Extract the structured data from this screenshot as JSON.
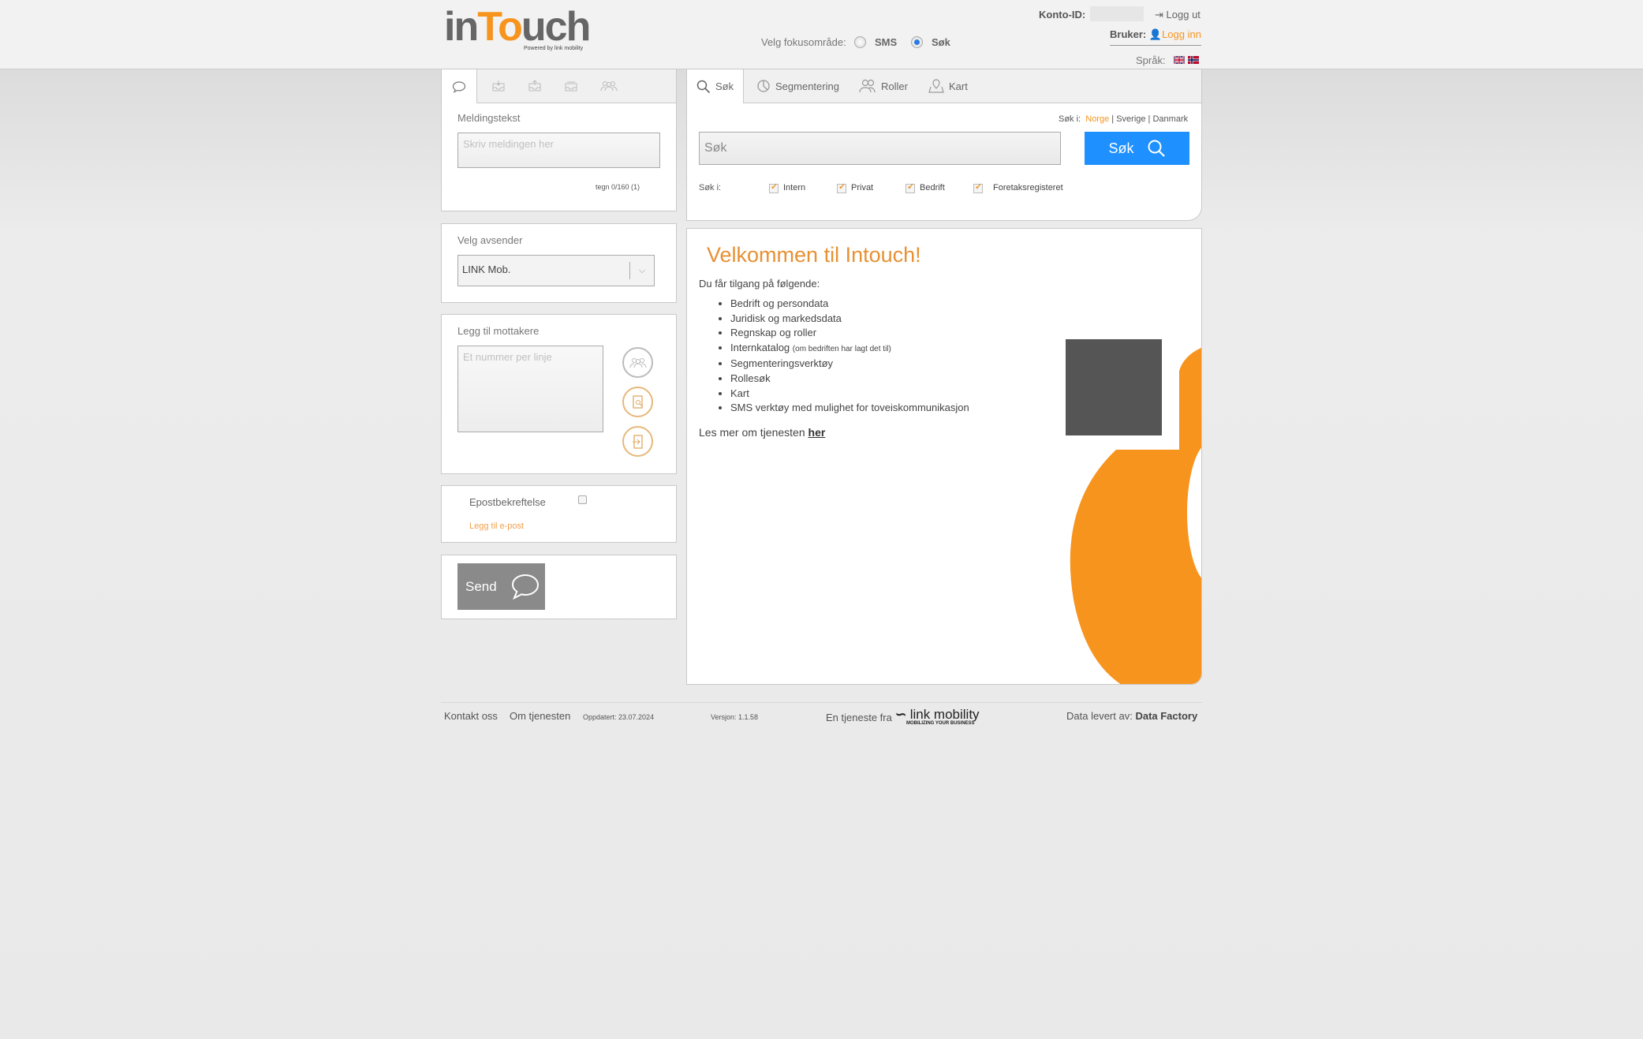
{
  "header": {
    "logo_left": "in",
    "logo_mid": "To",
    "logo_right": "uch",
    "logo_sub": "Powered by link mobility",
    "focus_label": "Velg fokusområde:",
    "focus_options": [
      "SMS",
      "Søk"
    ],
    "focus_selected": "Søk",
    "konto_label": "Konto-ID:",
    "logout": "Logg ut",
    "bruker_label": "Bruker:",
    "login": "Logg inn",
    "sprak_label": "Språk:"
  },
  "left": {
    "tabs": [
      "message-icon",
      "inbox-icon",
      "outbox-icon",
      "archive-icon",
      "groups-icon"
    ],
    "melding_title": "Meldingstekst",
    "melding_placeholder": "Skriv meldingen her",
    "counter": "tegn 0/160 (1)",
    "avsender_title": "Velg avsender",
    "avsender_value": "LINK Mob.",
    "mottakere_title": "Legg til mottakere",
    "mottakere_placeholder": "Et nummer per linje",
    "epost_label": "Epostbekreftelse",
    "epost_link": "Legg til e-post",
    "send_label": "Send"
  },
  "search": {
    "tabs": [
      "Søk",
      "Segmentering",
      "Roller",
      "Kart"
    ],
    "region_label": "Søk i:",
    "regions": [
      "Norge",
      "Sverige",
      "Danmark"
    ],
    "region_active": "Norge",
    "placeholder": "Søk",
    "button": "Søk",
    "filter_label": "Søk i:",
    "filters": [
      "Intern",
      "Privat",
      "Bedrift",
      "Foretaksregisteret"
    ]
  },
  "welcome": {
    "title": "Velkommen til Intouch!",
    "intro": "Du får tilgang på følgende:",
    "features": [
      "Bedrift og persondata",
      "Juridisk og markedsdata",
      "Regnskap og roller",
      "Internkatalog",
      "Segmenteringsverktøy",
      "Rollesøk",
      "Kart",
      "SMS verktøy med mulighet for toveiskommunikasjon"
    ],
    "internkatalog_note": "(om bedriften har lagt det til)",
    "more_text": "Les mer om tjenesten",
    "more_link": "her"
  },
  "footer": {
    "kontakt": "Kontakt oss",
    "om": "Om tjenesten",
    "oppdatert": "Oppdatert: 23.07.2024",
    "versjon": "Versjon: 1.1.58",
    "tjeneste": "En tjeneste fra",
    "brand": "link mobility",
    "brand_tag": "MOBILIZING YOUR BUSINESS",
    "levert_label": "Data levert av:",
    "levert": "Data Factory"
  },
  "colors": {
    "accent": "#f7941d",
    "search_button": "#1e90ff",
    "send_button": "#8a8a8a"
  }
}
